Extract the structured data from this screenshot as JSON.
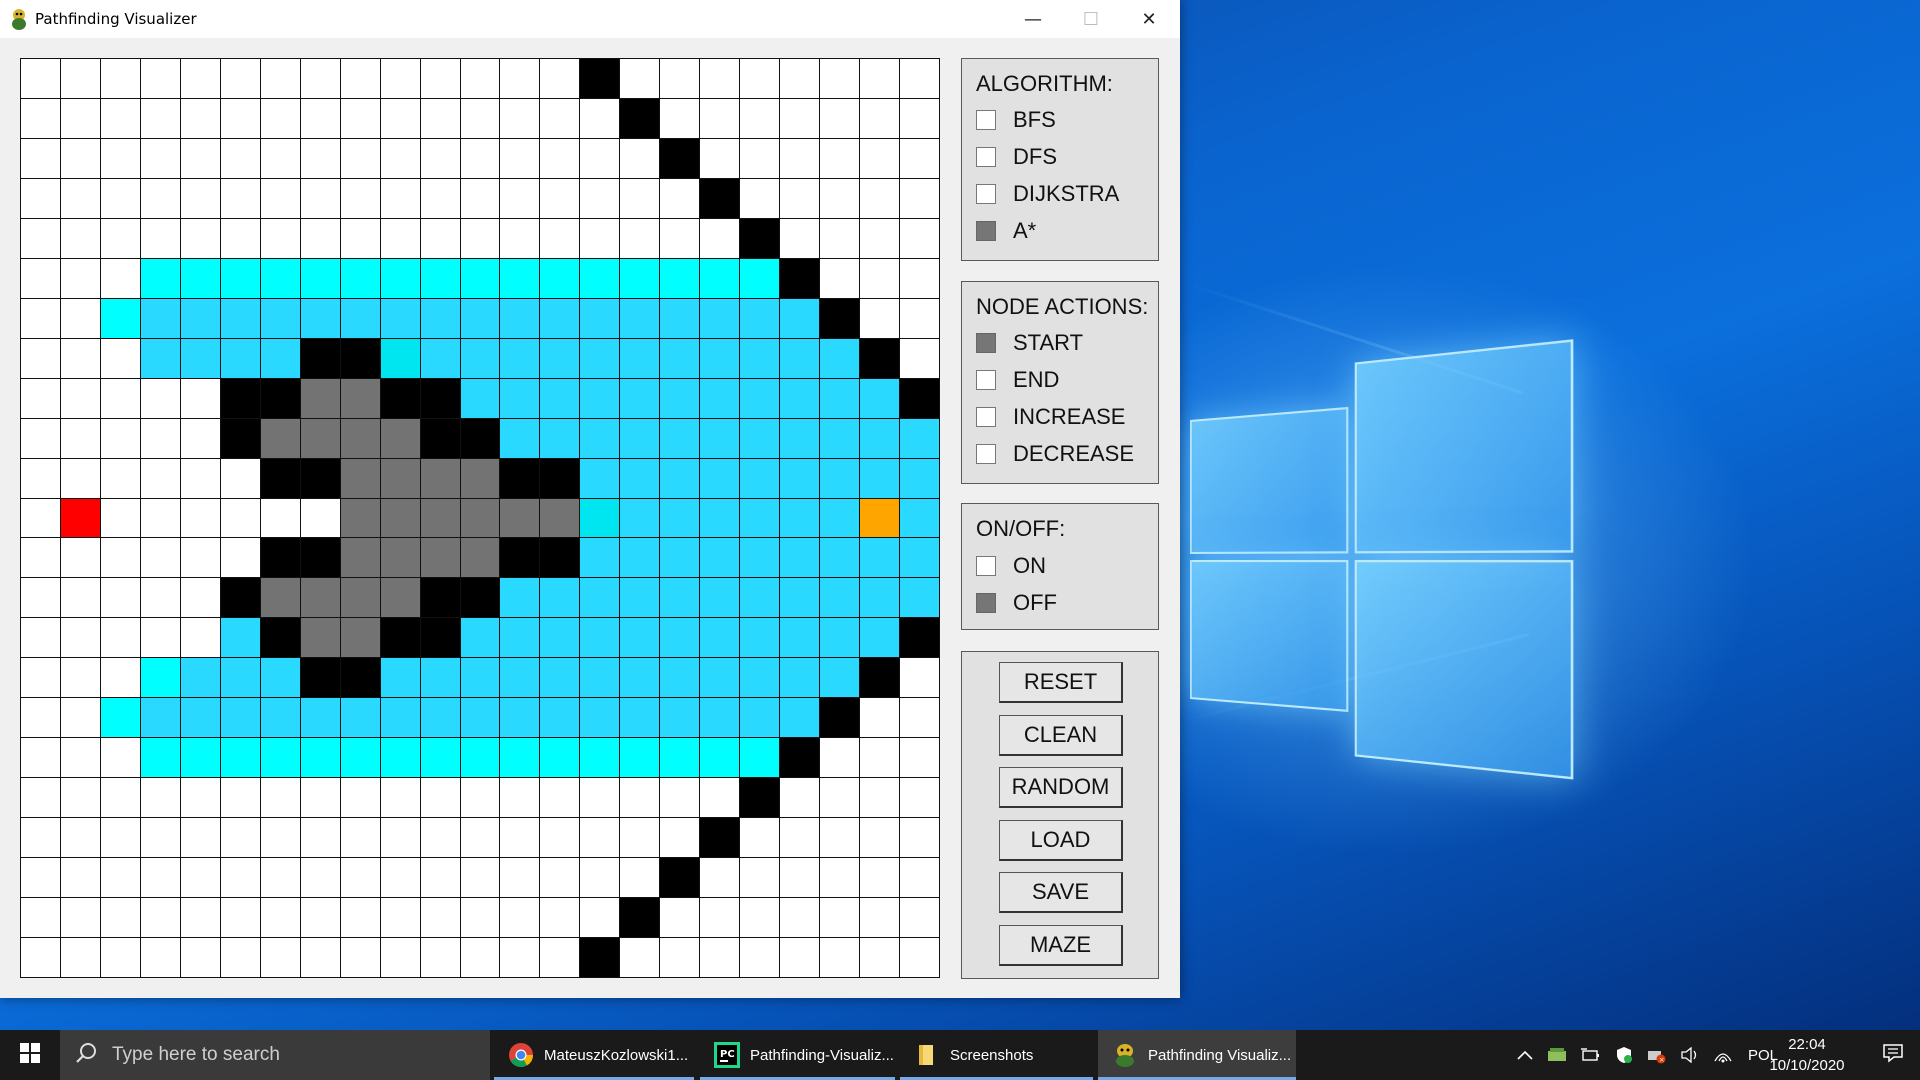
{
  "window": {
    "title": "Pathfinding Visualizer",
    "minimize_glyph": "—",
    "maximize_glyph": "☐",
    "close_glyph": "✕"
  },
  "grid": {
    "cols": 23,
    "rows": 23,
    "legend_colors": {
      "0": "#ffffff",
      "1": "#000000",
      "2": "#00ffff",
      "3": "#29d9ff",
      "4": "#737373",
      "5": "#ff0000",
      "6": "#ffa500",
      "7": "#00e6f0"
    },
    "cells": [
      "00000000000000100000000",
      "00000000000000010000000",
      "00000000000000001000000",
      "00000000000000000100000",
      "00000000000000000010000",
      "00022222222222222221000",
      "00233333333333333333100",
      "00033331173333333333310",
      "00000114411333333333331",
      "00000144441133333333333",
      "00000011444411333333333",
      "05000000444444733333363",
      "00000011444411333333333",
      "00000144441133333333333",
      "00000314411333333333331",
      "00023331133333333333310",
      "00233333333333333333100",
      "00022222222222222221000",
      "00000000000000000010000",
      "00000000000000000100000",
      "00000000000000001000000",
      "00000000000000010000000",
      "00000000000000100000000"
    ]
  },
  "algorithm_panel": {
    "title": "ALGORITHM:",
    "options": [
      {
        "label": "BFS",
        "checked": false
      },
      {
        "label": "DFS",
        "checked": false
      },
      {
        "label": "DIJKSTRA",
        "checked": false
      },
      {
        "label": "A*",
        "checked": true
      }
    ]
  },
  "node_actions_panel": {
    "title": "NODE ACTIONS:",
    "options": [
      {
        "label": "START",
        "checked": true
      },
      {
        "label": "END",
        "checked": false
      },
      {
        "label": "INCREASE",
        "checked": false
      },
      {
        "label": "DECREASE",
        "checked": false
      }
    ]
  },
  "onoff_panel": {
    "title": "ON/OFF:",
    "options": [
      {
        "label": "ON",
        "checked": false
      },
      {
        "label": "OFF",
        "checked": true
      }
    ]
  },
  "buttons_panel": {
    "buttons": [
      "RESET",
      "CLEAN",
      "RANDOM",
      "LOAD",
      "SAVE",
      "MAZE"
    ]
  },
  "taskbar": {
    "search_placeholder": "Type here to search",
    "tasks": [
      {
        "label": "MateuszKozlowski1...",
        "icon": "chrome-icon",
        "active": false
      },
      {
        "label": "Pathfinding-Visualiz...",
        "icon": "pycharm-icon",
        "active": false
      },
      {
        "label": "Screenshots",
        "icon": "folder-icon",
        "active": false
      },
      {
        "label": "Pathfinding Visualiz...",
        "icon": "pygame-icon",
        "active": true
      }
    ],
    "language": "POL",
    "time": "22:04",
    "date": "10/10/2020"
  }
}
